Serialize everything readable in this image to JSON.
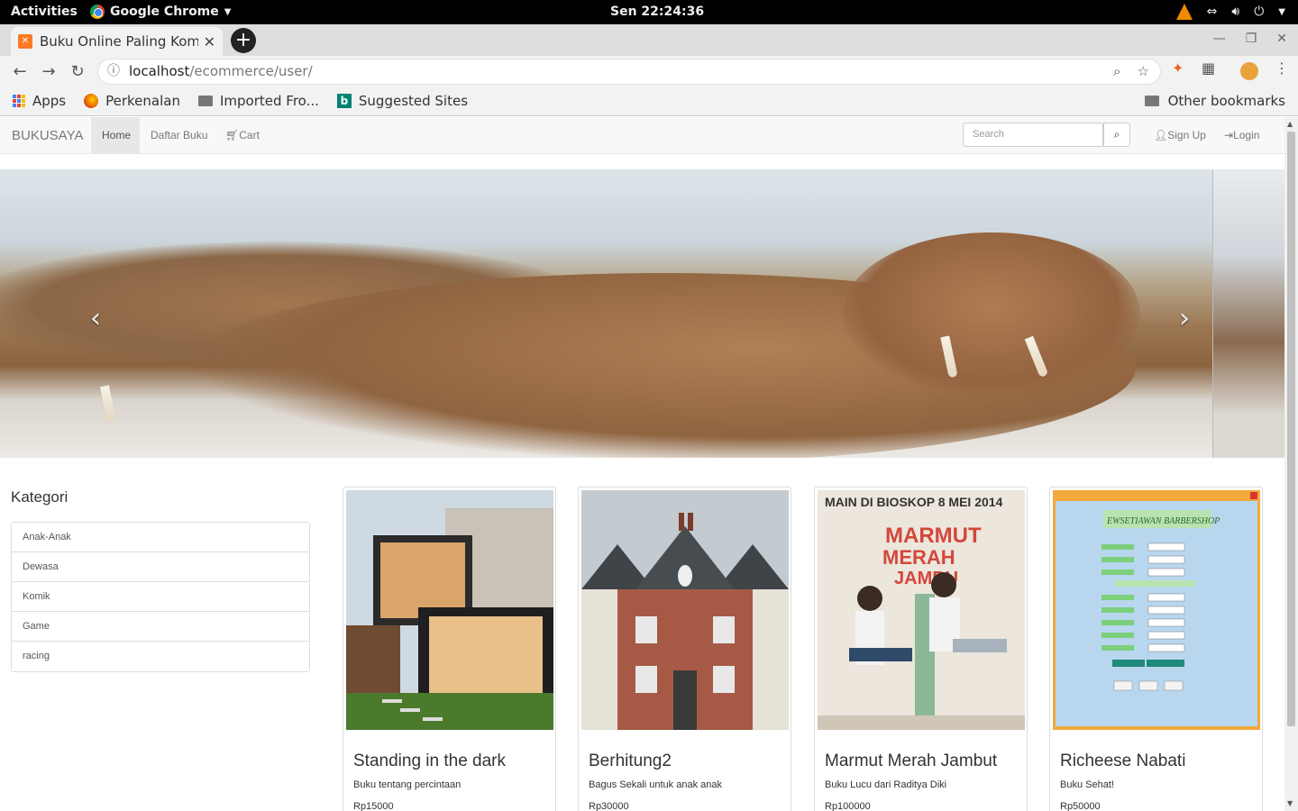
{
  "system_bar": {
    "activities": "Activities",
    "app_name": "Google Chrome",
    "clock": "Sen 22:24:36"
  },
  "browser": {
    "tab_title": "Buku Online Paling Komp",
    "url_host": "localhost",
    "url_path": "/ecommerce/user/",
    "bookmarks": {
      "apps": "Apps",
      "perkenalan": "Perkenalan",
      "imported": "Imported Fro...",
      "suggested": "Suggested Sites",
      "other": "Other bookmarks"
    }
  },
  "navbar": {
    "brand": "BUKUSAYA",
    "links": {
      "home": "Home",
      "daftar_buku": "Daftar Buku",
      "cart": "Cart"
    },
    "search_placeholder": "Search",
    "signup": "Sign Up",
    "login": "Login"
  },
  "sidebar": {
    "title": "Kategori",
    "items": [
      "Anak-Anak",
      "Dewasa",
      "Komik",
      "Game",
      "racing"
    ]
  },
  "products": [
    {
      "title": "Standing in the dark",
      "desc": "Buku tentang percintaan",
      "price": "Rp15000"
    },
    {
      "title": "Berhitung2",
      "desc": "Bagus Sekali untuk anak anak",
      "price": "Rp30000"
    },
    {
      "title": "Marmut Merah Jambut",
      "desc": "Buku Lucu dari Raditya Diki",
      "price": "Rp100000"
    },
    {
      "title": "Richeese Nabati",
      "desc": "Buku Sehat!",
      "price": "Rp50000"
    }
  ],
  "poster": {
    "headline": "MAIN DI BIOSKOP 8 MEI 2014",
    "title_line1": "MARMUT",
    "title_line2": "MERAH",
    "title_line3": "JAMBU"
  },
  "form_thumb": {
    "heading": "EWSETIAWAN BARBERSHOP"
  },
  "colors": {
    "navbar_bg": "#f8f8f8",
    "active_nav_bg": "#e7e7e7",
    "border": "#dddddd",
    "text": "#333333"
  }
}
